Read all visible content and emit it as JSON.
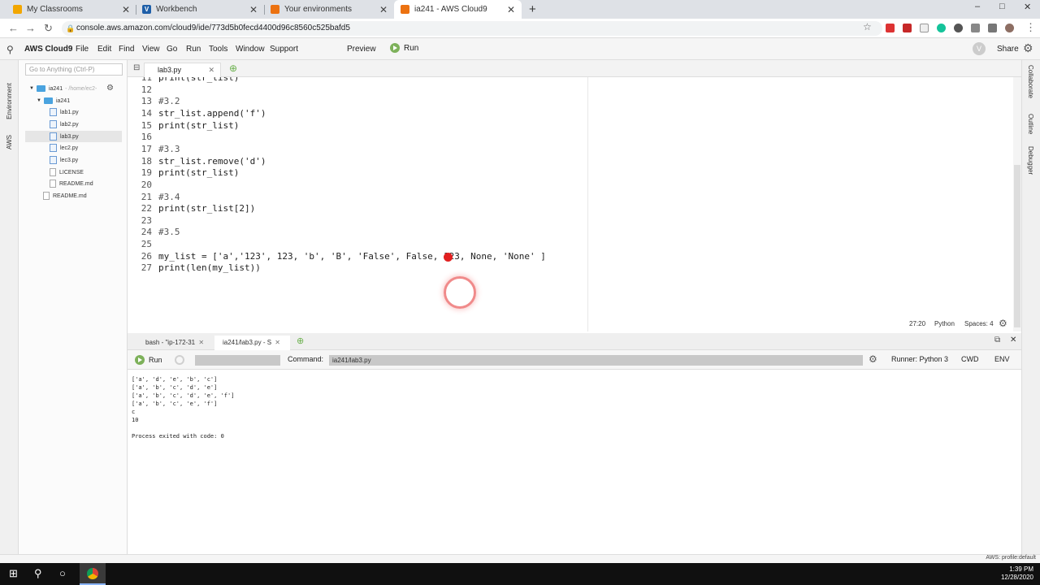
{
  "browser": {
    "tabs": [
      {
        "title": "My Classrooms",
        "color": "#f2a600"
      },
      {
        "title": "Workbench",
        "color": "#1e5fa8"
      },
      {
        "title": "Your environments",
        "color": "#ec7211"
      },
      {
        "title": "ia241 - AWS Cloud9",
        "color": "#ec7211"
      }
    ],
    "url": "console.aws.amazon.com/cloud9/ide/773d5b0fecd4400d96c8560c525bafd5",
    "window_controls": [
      "–",
      "□",
      "✕"
    ]
  },
  "c9": {
    "brand": "AWS Cloud9",
    "menus": [
      "File",
      "Edit",
      "Find",
      "View",
      "Go",
      "Run",
      "Tools",
      "Window",
      "Support"
    ],
    "preview": "Preview",
    "run": "Run",
    "avatar": "V",
    "share": "Share"
  },
  "leftrail": {
    "environment": "Environment",
    "aws": "AWS"
  },
  "rightrail": {
    "collaborate": "Collaborate",
    "outline": "Outline",
    "debugger": "Debugger"
  },
  "tree": {
    "goto_placeholder": "Go to Anything (Ctrl-P)",
    "root": "ia241",
    "root_path": "- /home/ec2-",
    "folder": "ia241",
    "files": [
      "lab1.py",
      "lab2.py",
      "lab3.py",
      "lec2.py",
      "lec3.py",
      "LICENSE",
      "README.md"
    ],
    "root_file": "README.md"
  },
  "editor": {
    "tab": "lab3.py",
    "lines": [
      {
        "n": "11",
        "t": "print(str_list)"
      },
      {
        "n": "12",
        "t": ""
      },
      {
        "n": "13",
        "t": "#3.2"
      },
      {
        "n": "14",
        "t": "str_list.append('f')"
      },
      {
        "n": "15",
        "t": "print(str_list)"
      },
      {
        "n": "16",
        "t": ""
      },
      {
        "n": "17",
        "t": "#3.3"
      },
      {
        "n": "18",
        "t": "str_list.remove('d')"
      },
      {
        "n": "19",
        "t": "print(str_list)"
      },
      {
        "n": "20",
        "t": ""
      },
      {
        "n": "21",
        "t": "#3.4"
      },
      {
        "n": "22",
        "t": "print(str_list[2])"
      },
      {
        "n": "23",
        "t": ""
      },
      {
        "n": "24",
        "t": "#3.5"
      },
      {
        "n": "25",
        "t": ""
      },
      {
        "n": "26",
        "t": "my_list = ['a','123', 123, 'b', 'B', 'False', False, 123, None, 'None' ]"
      },
      {
        "n": "27",
        "t": "print(len(my_list))"
      }
    ],
    "status_pos": "27:20",
    "status_lang": "Python",
    "status_spaces": "Spaces: 4"
  },
  "panel": {
    "tab_bash": "bash - \"ip-172-31",
    "tab_run": "ia241/lab3.py - S",
    "run": "Run",
    "command_label": "Command:",
    "command": "ia241/lab3.py",
    "runner": "Runner: Python 3",
    "cwd": "CWD",
    "env": "ENV",
    "output": [
      "['a', 'd', 'e', 'b', 'c']",
      "['a', 'b', 'c', 'd', 'e']",
      "['a', 'b', 'c', 'd', 'e', 'f']",
      "['a', 'b', 'c', 'e', 'f']",
      "c",
      "10",
      "",
      "Process exited with code: 0"
    ]
  },
  "footer": {
    "profile": "AWS: profile:default"
  },
  "taskbar": {
    "time": "1:39 PM",
    "date": "12/28/2020"
  }
}
